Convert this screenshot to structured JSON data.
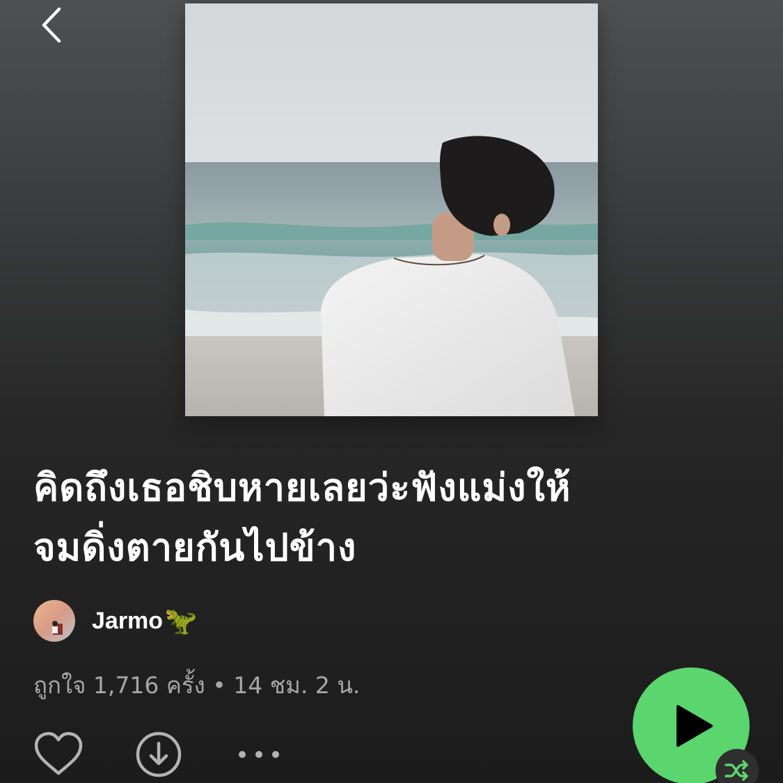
{
  "header": {
    "back_icon": "chevron-left-icon"
  },
  "playlist": {
    "title_line1": "คิดถึงเธอชิบหายเลยว่ะฟังแม่งให้",
    "title_line2": "จมดิ่งตายกันไปข้าง",
    "owner_name": "Jarmo",
    "owner_emoji": "🦖",
    "meta_text": "ถูกใจ 1,716 ครั้ง • 14 ชม. 2 น."
  },
  "actions": {
    "like_icon": "heart-outline-icon",
    "download_icon": "download-circle-icon",
    "more_icon": "more-dots-icon",
    "play_icon": "play-icon",
    "shuffle_icon": "shuffle-icon"
  },
  "colors": {
    "accent": "#5bd56e",
    "secondary_text": "#a7a7a7"
  }
}
